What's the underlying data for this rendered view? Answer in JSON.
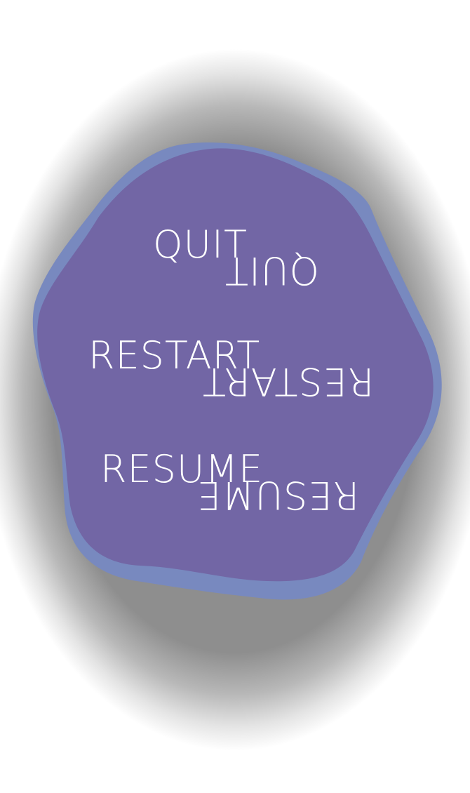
{
  "menu": {
    "items": [
      {
        "label": "QUIT"
      },
      {
        "label": "RESTART"
      },
      {
        "label": "RESUME"
      }
    ]
  },
  "colors": {
    "backdrop": "#8e8e8e",
    "blob_outer": "#7889bf",
    "blob_inner": "#7266a5",
    "text": "#ffffff"
  }
}
